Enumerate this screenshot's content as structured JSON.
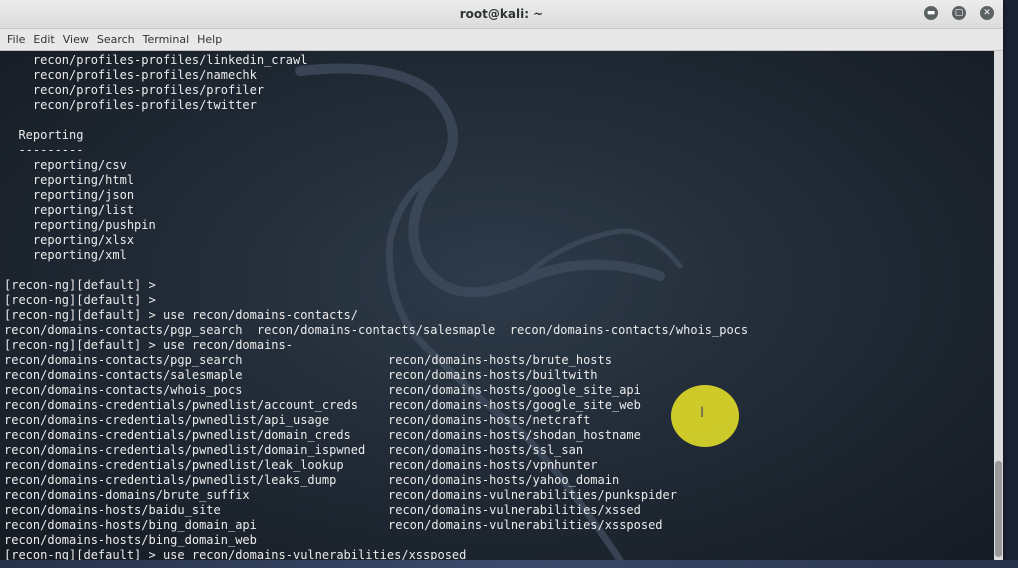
{
  "window": {
    "title": "root@kali: ~"
  },
  "window_buttons": [
    {
      "name": "minimize-icon",
      "glyph": "▬"
    },
    {
      "name": "maximize-icon",
      "glyph": "▢"
    },
    {
      "name": "close-icon",
      "glyph": "✕"
    }
  ],
  "menu": [
    "File",
    "Edit",
    "View",
    "Search",
    "Terminal",
    "Help"
  ],
  "terminal": {
    "top_lines": [
      "    recon/profiles-profiles/linkedin_crawl",
      "    recon/profiles-profiles/namechk",
      "    recon/profiles-profiles/profiler",
      "    recon/profiles-profiles/twitter",
      "",
      "  Reporting",
      "  ---------",
      "    reporting/csv",
      "    reporting/html",
      "    reporting/json",
      "    reporting/list",
      "    reporting/pushpin",
      "    reporting/xlsx",
      "    reporting/xml",
      "",
      "[recon-ng][default] >",
      "[recon-ng][default] >",
      "[recon-ng][default] > use recon/domains-contacts/",
      "recon/domains-contacts/pgp_search  recon/domains-contacts/salesmaple  recon/domains-contacts/whois_pocs",
      "[recon-ng][default] > use recon/domains-"
    ],
    "col1": [
      "recon/domains-contacts/pgp_search",
      "recon/domains-contacts/salesmaple",
      "recon/domains-contacts/whois_pocs",
      "recon/domains-credentials/pwnedlist/account_creds",
      "recon/domains-credentials/pwnedlist/api_usage",
      "recon/domains-credentials/pwnedlist/domain_creds",
      "recon/domains-credentials/pwnedlist/domain_ispwned",
      "recon/domains-credentials/pwnedlist/leak_lookup",
      "recon/domains-credentials/pwnedlist/leaks_dump",
      "recon/domains-domains/brute_suffix",
      "recon/domains-hosts/baidu_site",
      "recon/domains-hosts/bing_domain_api",
      "recon/domains-hosts/bing_domain_web"
    ],
    "col2": [
      "recon/domains-hosts/brute_hosts",
      "recon/domains-hosts/builtwith",
      "recon/domains-hosts/google_site_api",
      "recon/domains-hosts/google_site_web",
      "recon/domains-hosts/netcraft",
      "recon/domains-hosts/shodan_hostname",
      "recon/domains-hosts/ssl_san",
      "recon/domains-hosts/vpnhunter",
      "recon/domains-hosts/yahoo_domain",
      "recon/domains-vulnerabilities/punkspider",
      "recon/domains-vulnerabilities/xssed",
      "recon/domains-vulnerabilities/xssposed"
    ],
    "last_line": "[recon-ng][default] > use recon/domains-vulnerabilities/xssposed"
  },
  "colors": {
    "background": "#1e2530",
    "text": "#ececec",
    "cursor_highlight": "#ebe628"
  }
}
